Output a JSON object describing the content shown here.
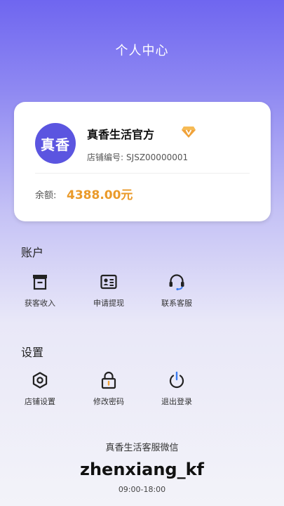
{
  "header": {
    "title": "个人中心"
  },
  "profile": {
    "avatar_text": "真香",
    "store_name": "真香生活官方",
    "store_id_label": "店铺编号:",
    "store_id": "SJSZ00000001",
    "balance_label": "余额:",
    "balance_value": "4388.00元",
    "vip_icon": "diamond-v-icon",
    "vip_color": "#f0a23a"
  },
  "account": {
    "title": "账户",
    "items": [
      {
        "label": "获客收入",
        "icon": "inbox-icon"
      },
      {
        "label": "申请提现",
        "icon": "id-card-icon"
      },
      {
        "label": "联系客服",
        "icon": "headset-icon"
      }
    ]
  },
  "settings": {
    "title": "设置",
    "items": [
      {
        "label": "店铺设置",
        "icon": "gear-icon"
      },
      {
        "label": "修改密码",
        "icon": "lock-icon"
      },
      {
        "label": "退出登录",
        "icon": "power-icon"
      }
    ]
  },
  "footer": {
    "label": "真香生活客服微信",
    "wechat_id": "zhenxiang_kf",
    "hours": "09:00-18:00"
  },
  "colors": {
    "accent": "#5b55e0",
    "balance": "#ea9a2a"
  }
}
